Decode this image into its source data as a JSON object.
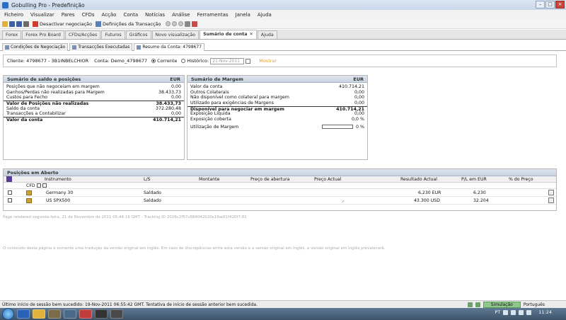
{
  "window": {
    "title": "Gobulling Pro - Predefinição",
    "buttons": [
      "–",
      "□",
      "×"
    ]
  },
  "menu": [
    "Ficheiro",
    "Visualizar",
    "Pares",
    "CFDs",
    "Acção",
    "Conta",
    "Notícias",
    "Análise",
    "Ferramentas",
    "Janela",
    "Ajuda"
  ],
  "toolbar": {
    "disable_trading": "Desactivar negociação",
    "trade_settings": "Definições da Transacção"
  },
  "main_tabs": [
    "Forex",
    "Forex Pro Board",
    "CFDs/Acções",
    "Futuros",
    "Gráficos",
    "Novo visualização",
    "Sumário de conta",
    "Ajuda"
  ],
  "sub_tabs": [
    "Condições de Negociação",
    "Transacções Executadas",
    "Resumo da Conta: 4798677"
  ],
  "client": {
    "client_label": "Cliente: 4798677 - 3B1INBELCHIOR",
    "account_label": "Conta: Demo_4798677",
    "current": "Corrente",
    "historic": "Histórico:",
    "date": "21-Nov-2011",
    "show": "Mostrar"
  },
  "balance": {
    "title": "Sumário de saldo e posições",
    "currency": "EUR",
    "rows": [
      {
        "label": "Posições que não negoceiam em margem",
        "value": "0,00",
        "bold": false,
        "sep": false
      },
      {
        "label": "Ganhos/Perdas não realizadas para Margem",
        "value": "38.433,73",
        "bold": false,
        "sep": false
      },
      {
        "label": "Custos para Fecho",
        "value": "0,00",
        "bold": false,
        "sep": false
      },
      {
        "label": "Valor de Posições não realizadas",
        "value": "38.433,73",
        "bold": true,
        "sep": true
      },
      {
        "label": "Saldo da conta",
        "value": "372.280,48",
        "bold": false,
        "sep": false
      },
      {
        "label": "Transacções a Contabilizar",
        "value": "0,00",
        "bold": false,
        "sep": false
      },
      {
        "label": "Valor da conta",
        "value": "410.714,21",
        "bold": true,
        "sep": true
      }
    ]
  },
  "margin": {
    "title": "Sumário de Margem",
    "currency": "EUR",
    "rows": [
      {
        "label": "Valor da conta",
        "value": "410.714,21",
        "bold": false,
        "sep": false
      },
      {
        "label": "Outros Colaterais",
        "value": "0,00",
        "bold": false,
        "sep": false
      },
      {
        "label": "Não disponível como colateral para margem",
        "value": "0,00",
        "bold": false,
        "sep": false
      },
      {
        "label": "Utilizado para exigências de Margens",
        "value": "0,00",
        "bold": false,
        "sep": false
      },
      {
        "label": "Disponível para negociar em margem",
        "value": "410.714,21",
        "bold": true,
        "sep": true
      },
      {
        "label": "Exposição Líquida",
        "value": "0,00",
        "bold": false,
        "sep": false
      },
      {
        "label": "Exposição coberta",
        "value": "0,0 %",
        "bold": false,
        "sep": false
      }
    ],
    "utilization_label": "Utilização de Margem",
    "utilization_value": "0 %",
    "utilization_fraction": 0
  },
  "positions": {
    "title": "Posições em Aberto",
    "columns": [
      "Instrumento",
      "L/S",
      "Montante",
      "Preço de abertura",
      "Preço Actual",
      "Resultado Actual",
      "P/L em EUR",
      "% do Preço"
    ],
    "sub": "CFD",
    "rows": [
      {
        "instrument": "Germany 30",
        "ls": "Saldado",
        "result": "6.230 EUR",
        "pl": "6.230"
      },
      {
        "instrument": "US SPX500",
        "ls": "Saldado",
        "result": "43.300 USD",
        "pl": "32.204"
      }
    ]
  },
  "footnotes": {
    "rendered": "Page rendered segunda-feira, 21 de Novembro de 2011 05:44:16 GMT - Tracking ID 2026c2f57c884042020c19adf1f420f7:81",
    "disclaimer": "O conteúdo desta página é somente uma tradução da versão original em Inglês. Em caso de discrepâncias entre esta versão e a versão original em Inglês, a versão original em Inglês prevalecerá."
  },
  "status": {
    "message": "Último início de sessão bem sucedido: 19-Nov-2011 06:55:42 GMT. Tentativa de início de sessão anterior bem sucedida.",
    "mode": "Simulação",
    "language": "Português"
  },
  "taskbar": {
    "lang": "PT",
    "time": "11:24"
  },
  "colors": {
    "simulation": "#8ec78a",
    "header": "#c9d3e1",
    "link": "#d8a030"
  }
}
